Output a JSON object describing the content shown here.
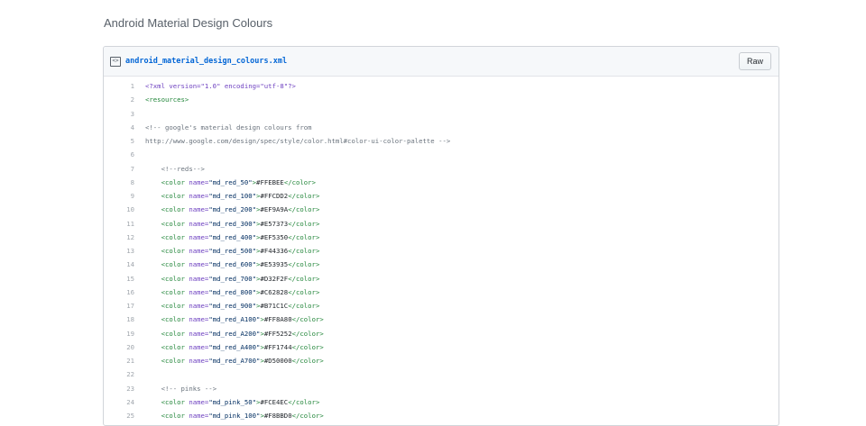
{
  "gist": {
    "description": "Android Material Design Colours"
  },
  "file": {
    "icon": "code-file-icon",
    "icon_glyph": "<>",
    "name": "android_material_design_colours.xml",
    "raw_label": "Raw"
  },
  "code": {
    "lines": [
      {
        "n": "1",
        "parts": [
          [
            "pi",
            "<?xml version=\"1.0\" encoding=\"utf-8\"?>"
          ]
        ]
      },
      {
        "n": "2",
        "parts": [
          [
            "tag",
            "<resources>"
          ]
        ]
      },
      {
        "n": "3",
        "parts": []
      },
      {
        "n": "4",
        "parts": [
          [
            "cmt",
            "<!-- google's material design colours from"
          ]
        ]
      },
      {
        "n": "5",
        "parts": [
          [
            "cmt",
            "http://www.google.com/design/spec/style/color.html#color-ui-color-palette -->"
          ]
        ]
      },
      {
        "n": "6",
        "parts": []
      },
      {
        "n": "7",
        "parts": [
          [
            "txt",
            "    "
          ],
          [
            "cmt",
            "<!--reds-->"
          ]
        ]
      },
      {
        "n": "8",
        "parts": [
          [
            "txt",
            "    "
          ],
          [
            "tag",
            "<color "
          ],
          [
            "attr",
            "name="
          ],
          [
            "str",
            "\"md_red_50\""
          ],
          [
            "tag",
            ">"
          ],
          [
            "txt",
            "#FFEBEE"
          ],
          [
            "tag",
            "</color>"
          ]
        ]
      },
      {
        "n": "9",
        "parts": [
          [
            "txt",
            "    "
          ],
          [
            "tag",
            "<color "
          ],
          [
            "attr",
            "name="
          ],
          [
            "str",
            "\"md_red_100\""
          ],
          [
            "tag",
            ">"
          ],
          [
            "txt",
            "#FFCDD2"
          ],
          [
            "tag",
            "</color>"
          ]
        ]
      },
      {
        "n": "10",
        "parts": [
          [
            "txt",
            "    "
          ],
          [
            "tag",
            "<color "
          ],
          [
            "attr",
            "name="
          ],
          [
            "str",
            "\"md_red_200\""
          ],
          [
            "tag",
            ">"
          ],
          [
            "txt",
            "#EF9A9A"
          ],
          [
            "tag",
            "</color>"
          ]
        ]
      },
      {
        "n": "11",
        "parts": [
          [
            "txt",
            "    "
          ],
          [
            "tag",
            "<color "
          ],
          [
            "attr",
            "name="
          ],
          [
            "str",
            "\"md_red_300\""
          ],
          [
            "tag",
            ">"
          ],
          [
            "txt",
            "#E57373"
          ],
          [
            "tag",
            "</color>"
          ]
        ]
      },
      {
        "n": "12",
        "parts": [
          [
            "txt",
            "    "
          ],
          [
            "tag",
            "<color "
          ],
          [
            "attr",
            "name="
          ],
          [
            "str",
            "\"md_red_400\""
          ],
          [
            "tag",
            ">"
          ],
          [
            "txt",
            "#EF5350"
          ],
          [
            "tag",
            "</color>"
          ]
        ]
      },
      {
        "n": "13",
        "parts": [
          [
            "txt",
            "    "
          ],
          [
            "tag",
            "<color "
          ],
          [
            "attr",
            "name="
          ],
          [
            "str",
            "\"md_red_500\""
          ],
          [
            "tag",
            ">"
          ],
          [
            "txt",
            "#F44336"
          ],
          [
            "tag",
            "</color>"
          ]
        ]
      },
      {
        "n": "14",
        "parts": [
          [
            "txt",
            "    "
          ],
          [
            "tag",
            "<color "
          ],
          [
            "attr",
            "name="
          ],
          [
            "str",
            "\"md_red_600\""
          ],
          [
            "tag",
            ">"
          ],
          [
            "txt",
            "#E53935"
          ],
          [
            "tag",
            "</color>"
          ]
        ]
      },
      {
        "n": "15",
        "parts": [
          [
            "txt",
            "    "
          ],
          [
            "tag",
            "<color "
          ],
          [
            "attr",
            "name="
          ],
          [
            "str",
            "\"md_red_700\""
          ],
          [
            "tag",
            ">"
          ],
          [
            "txt",
            "#D32F2F"
          ],
          [
            "tag",
            "</color>"
          ]
        ]
      },
      {
        "n": "16",
        "parts": [
          [
            "txt",
            "    "
          ],
          [
            "tag",
            "<color "
          ],
          [
            "attr",
            "name="
          ],
          [
            "str",
            "\"md_red_800\""
          ],
          [
            "tag",
            ">"
          ],
          [
            "txt",
            "#C62828"
          ],
          [
            "tag",
            "</color>"
          ]
        ]
      },
      {
        "n": "17",
        "parts": [
          [
            "txt",
            "    "
          ],
          [
            "tag",
            "<color "
          ],
          [
            "attr",
            "name="
          ],
          [
            "str",
            "\"md_red_900\""
          ],
          [
            "tag",
            ">"
          ],
          [
            "txt",
            "#B71C1C"
          ],
          [
            "tag",
            "</color>"
          ]
        ]
      },
      {
        "n": "18",
        "parts": [
          [
            "txt",
            "    "
          ],
          [
            "tag",
            "<color "
          ],
          [
            "attr",
            "name="
          ],
          [
            "str",
            "\"md_red_A100\""
          ],
          [
            "tag",
            ">"
          ],
          [
            "txt",
            "#FF8A80"
          ],
          [
            "tag",
            "</color>"
          ]
        ]
      },
      {
        "n": "19",
        "parts": [
          [
            "txt",
            "    "
          ],
          [
            "tag",
            "<color "
          ],
          [
            "attr",
            "name="
          ],
          [
            "str",
            "\"md_red_A200\""
          ],
          [
            "tag",
            ">"
          ],
          [
            "txt",
            "#FF5252"
          ],
          [
            "tag",
            "</color>"
          ]
        ]
      },
      {
        "n": "20",
        "parts": [
          [
            "txt",
            "    "
          ],
          [
            "tag",
            "<color "
          ],
          [
            "attr",
            "name="
          ],
          [
            "str",
            "\"md_red_A400\""
          ],
          [
            "tag",
            ">"
          ],
          [
            "txt",
            "#FF1744"
          ],
          [
            "tag",
            "</color>"
          ]
        ]
      },
      {
        "n": "21",
        "parts": [
          [
            "txt",
            "    "
          ],
          [
            "tag",
            "<color "
          ],
          [
            "attr",
            "name="
          ],
          [
            "str",
            "\"md_red_A700\""
          ],
          [
            "tag",
            ">"
          ],
          [
            "txt",
            "#D50000"
          ],
          [
            "tag",
            "</color>"
          ]
        ]
      },
      {
        "n": "22",
        "parts": []
      },
      {
        "n": "23",
        "parts": [
          [
            "txt",
            "    "
          ],
          [
            "cmt",
            "<!-- pinks -->"
          ]
        ]
      },
      {
        "n": "24",
        "parts": [
          [
            "txt",
            "    "
          ],
          [
            "tag",
            "<color "
          ],
          [
            "attr",
            "name="
          ],
          [
            "str",
            "\"md_pink_50\""
          ],
          [
            "tag",
            ">"
          ],
          [
            "txt",
            "#FCE4EC"
          ],
          [
            "tag",
            "</color>"
          ]
        ]
      },
      {
        "n": "25",
        "parts": [
          [
            "txt",
            "    "
          ],
          [
            "tag",
            "<color "
          ],
          [
            "attr",
            "name="
          ],
          [
            "str",
            "\"md_pink_100\""
          ],
          [
            "tag",
            ">"
          ],
          [
            "txt",
            "#F8BBD0"
          ],
          [
            "tag",
            "</color>"
          ]
        ]
      }
    ]
  },
  "colors": {
    "link": "#0366d6",
    "tag": "#22863a",
    "attr": "#6f42c1",
    "string": "#032f62",
    "comment": "#6a737d",
    "line_number": "#a0a6ad",
    "border": "#d1d5da"
  }
}
